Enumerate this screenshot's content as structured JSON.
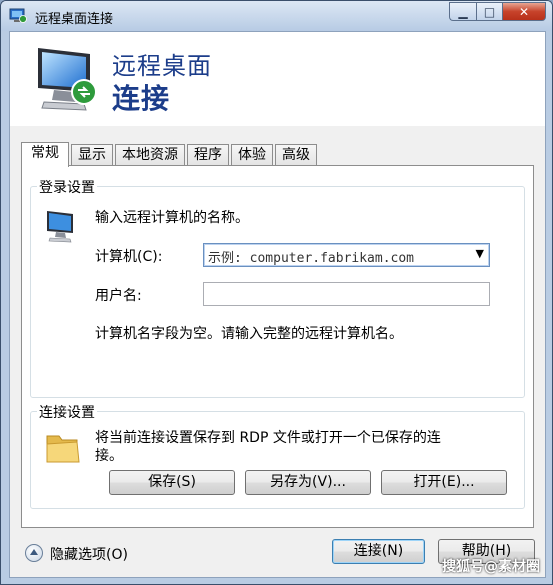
{
  "window": {
    "title": "远程桌面连接",
    "caption_min": "▁",
    "caption_max": "□",
    "caption_close": "✕"
  },
  "banner": {
    "line1": "远程桌面",
    "line2": "连接"
  },
  "tabs": [
    {
      "label": "常规",
      "active": true
    },
    {
      "label": "显示",
      "active": false
    },
    {
      "label": "本地资源",
      "active": false
    },
    {
      "label": "程序",
      "active": false
    },
    {
      "label": "体验",
      "active": false
    },
    {
      "label": "高级",
      "active": false
    }
  ],
  "login": {
    "legend": "登录设置",
    "prompt": "输入远程计算机的名称。",
    "computer_label": "计算机(C):",
    "computer_placeholder": "示例: computer.fabrikam.com",
    "user_label": "用户名:",
    "user_value": "",
    "warning": "计算机名字段为空。请输入完整的远程计算机名。"
  },
  "connection": {
    "legend": "连接设置",
    "desc_line1": "将当前连接设置保存到 RDP 文件或打开一个已保存的连",
    "desc_line2": "接。",
    "save_label": "保存(S)",
    "saveas_label": "另存为(V)...",
    "open_label": "打开(E)..."
  },
  "footer": {
    "hide_options_label": "隐藏选项(O)",
    "connect_label": "连接(N)",
    "help_label": "帮助(H)"
  },
  "watermark": "搜狐号@素材圈",
  "colors": {
    "banner_text": "#1c3d8a",
    "titlebar": "#c9d8ea",
    "close_button": "#c7432b"
  },
  "icons": {
    "title": "remote-desktop-icon",
    "banner": "monitor-connection-icon",
    "login": "computer-icon",
    "connection": "folder-icon"
  }
}
